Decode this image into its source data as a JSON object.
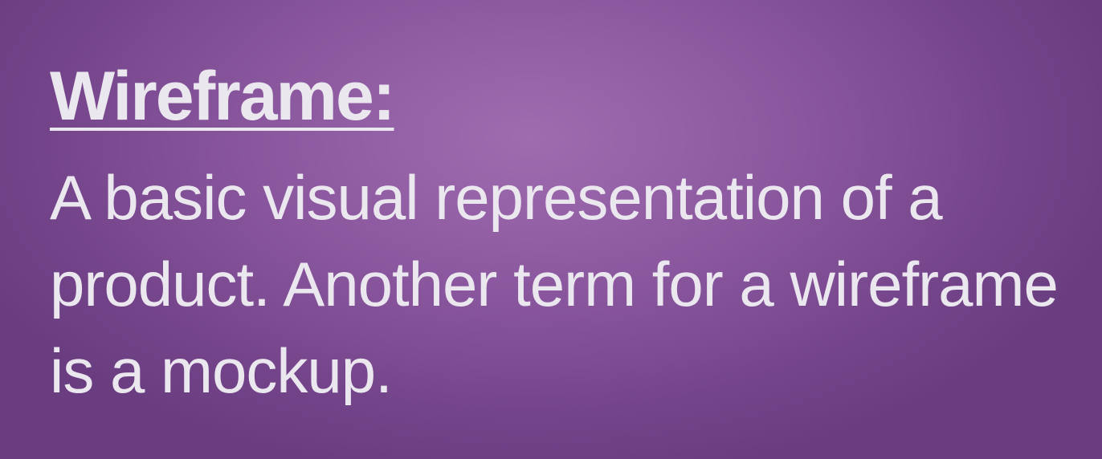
{
  "slide": {
    "term": "Wireframe:",
    "definition": "A basic visual representation of a product. Another term for a wireframe is a mockup."
  },
  "colors": {
    "background": "#8a579e",
    "text": "#ebe7ef"
  }
}
